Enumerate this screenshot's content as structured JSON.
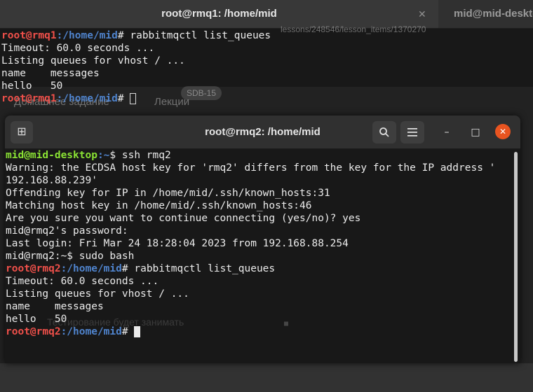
{
  "back_window": {
    "active_tab": "root@rmq1: /home/mid",
    "inactive_tab": "mid@mid-deskto",
    "tab_close": "✕",
    "prompt_user": "root@rmq1",
    "prompt_path": ":/home/mid",
    "prompt_symbol": "#",
    "command": " rabbitmqctl list_queues",
    "output": [
      "Timeout: 60.0 seconds ...",
      "Listing queues for vhost / ...",
      "name    messages",
      "hello   50"
    ],
    "ghost_url": "lessons/248546/lesson_items/1370270",
    "ghost_badge": "SDB-15",
    "ghost_tab_lectures": "Лекции",
    "ghost_tab_left": "Домашнее задание",
    "ghost_x": "✕"
  },
  "front_window": {
    "title": "root@rmq2: /home/mid",
    "buttons": {
      "new_tab_icon": "⊞",
      "search_icon": "⌕",
      "menu_icon": "☰",
      "minimize": "–",
      "maximize": "□",
      "close": "✕"
    },
    "session": {
      "desktop_user": "mid@mid-desktop",
      "desktop_path": ":~",
      "desktop_symbol": "$",
      "ssh_command": " ssh rmq2",
      "lines": [
        "Warning: the ECDSA host key for 'rmq2' differs from the key for the IP address '",
        "192.168.88.239'",
        "Offending key for IP in /home/mid/.ssh/known_hosts:31",
        "Matching host key in /home/mid/.ssh/known_hosts:46",
        "Are you sure you want to continue connecting (yes/no)? yes",
        "mid@rmq2's password:",
        "Last login: Fri Mar 24 18:28:04 2023 from 192.168.88.254",
        "mid@rmq2:~$ sudo bash"
      ],
      "prompt_user": "root@rmq2",
      "prompt_path": ":/home/mid",
      "prompt_symbol": "#",
      "command": " rabbitmqctl list_queues",
      "output": [
        "Timeout: 60.0 seconds ...",
        "Listing queues for vhost / ...",
        "name    messages",
        "hello   50"
      ],
      "ghost_overlay": "Тестирование будет занимать"
    }
  }
}
